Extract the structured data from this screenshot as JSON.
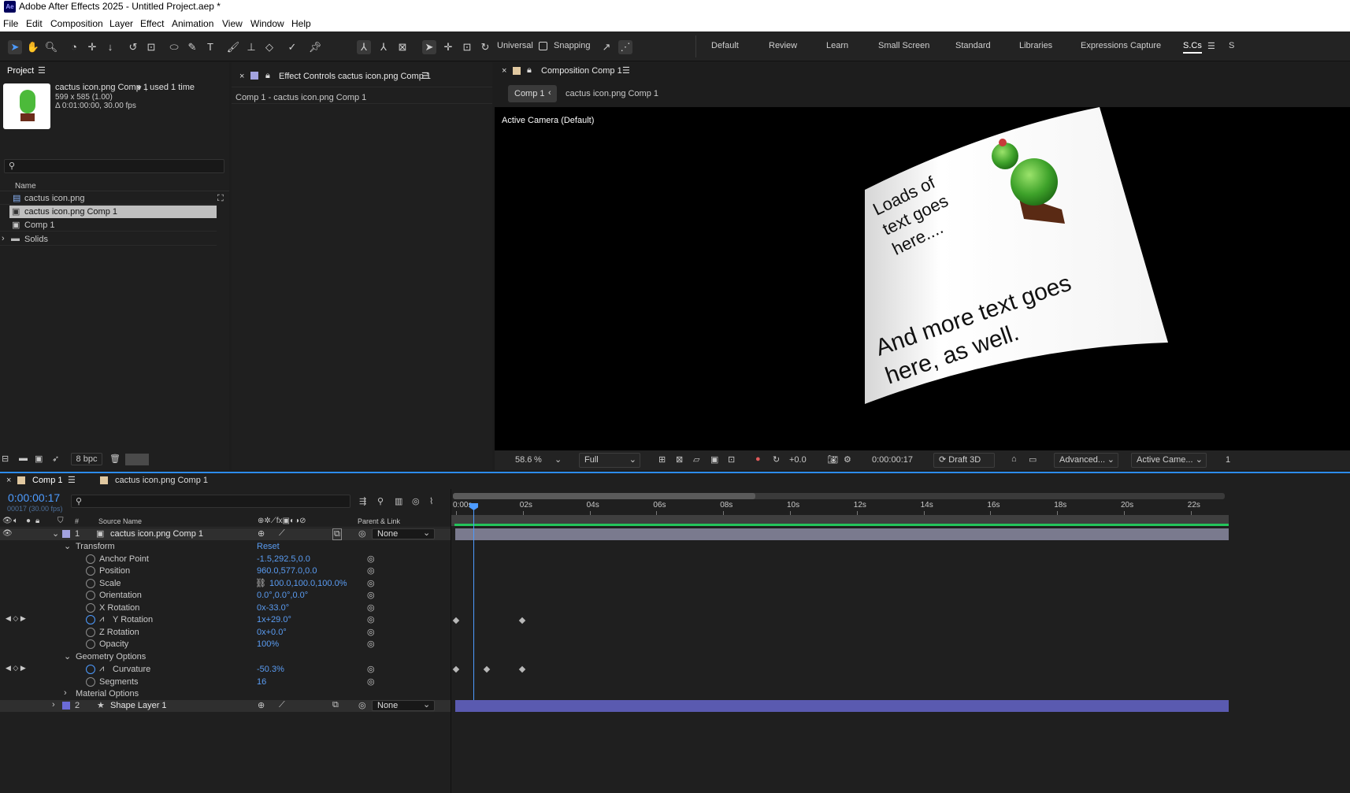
{
  "window": {
    "title": "Adobe After Effects 2025 - Untitled Project.aep *",
    "logo": "Ae"
  },
  "menu": [
    "File",
    "Edit",
    "Composition",
    "Layer",
    "Effect",
    "Animation",
    "View",
    "Window",
    "Help"
  ],
  "toolbar": {
    "universal_label": "Universal",
    "snapping_label": "Snapping",
    "workspaces": [
      "Default",
      "Review",
      "Learn",
      "Small Screen",
      "Standard",
      "Libraries",
      "Expressions Capture",
      "S.Cs"
    ],
    "active_workspace": "S.Cs",
    "cut_text": "S"
  },
  "project": {
    "tab": "Project",
    "item_name": "cactus icon.png Comp 1",
    "item_used": ", used 1 time",
    "item_size": "599 x 585 (1.00)",
    "item_duration": "Δ 0:01:00:00, 30.00 fps",
    "col_name": "Name",
    "items": [
      "cactus icon.png",
      "cactus icon.png Comp 1",
      "Comp 1",
      "Solids"
    ],
    "bpc": "8 bpc"
  },
  "effect_controls": {
    "tab": "Effect Controls cactus icon.png Comp 1",
    "subtitle": "Comp 1 - cactus icon.png Comp 1"
  },
  "composition": {
    "tab": "Composition Comp 1",
    "breadcrumb": [
      "Comp 1",
      "cactus icon.png Comp 1"
    ],
    "camera_label": "Active Camera (Default)",
    "text1": [
      "Loads of",
      "text goes",
      "here...."
    ],
    "text2": [
      "And more text goes",
      "here, as well."
    ],
    "zoom": "58.6",
    "zoom_unit": "%",
    "resolution": "Full",
    "exposure": "+0.0",
    "timecode": "0:00:00:17",
    "renderer": "Draft 3D",
    "advanced": "Advanced...",
    "view": "Active Came...",
    "views_count": "1"
  },
  "timeline": {
    "tab_active": "Comp 1",
    "tab_other": "cactus icon.png Comp 1",
    "time": "0:00:00:17",
    "frame_info": "00017 (30.00 fps)",
    "col_source": "Source Name",
    "col_parent": "Parent & Link",
    "ruler": [
      "0:00s",
      "02s",
      "04s",
      "06s",
      "08s",
      "10s",
      "12s",
      "14s",
      "16s",
      "18s",
      "20s",
      "22s"
    ],
    "layer1": {
      "num": "1",
      "name": "cactus icon.png Comp 1",
      "parent": "None"
    },
    "layer2": {
      "num": "2",
      "name": "Shape Layer 1",
      "parent": "None"
    },
    "transform": "Transform",
    "reset": "Reset",
    "props": [
      {
        "name": "Anchor Point",
        "value": "-1.5,292.5,0.0"
      },
      {
        "name": "Position",
        "value": "960.0,577.0,0.0"
      },
      {
        "name": "Scale",
        "value": "100.0,100.0,100.0%"
      },
      {
        "name": "Orientation",
        "value": "0.0°,0.0°,0.0°"
      },
      {
        "name": "X Rotation",
        "value": "0x-33.0°"
      },
      {
        "name": "Y Rotation",
        "value": "1x+29.0°"
      },
      {
        "name": "Z Rotation",
        "value": "0x+0.0°"
      },
      {
        "name": "Opacity",
        "value": "100%"
      }
    ],
    "geometry": "Geometry Options",
    "geo_props": [
      {
        "name": "Curvature",
        "value": "-50.3%"
      },
      {
        "name": "Segments",
        "value": "16"
      }
    ],
    "material": "Material Options"
  },
  "colors": {
    "accent": "#2d8ceb",
    "label_lavender": "#a3a3e0",
    "label_blue": "#6b6bd6",
    "green_bar": "#23c45b"
  }
}
